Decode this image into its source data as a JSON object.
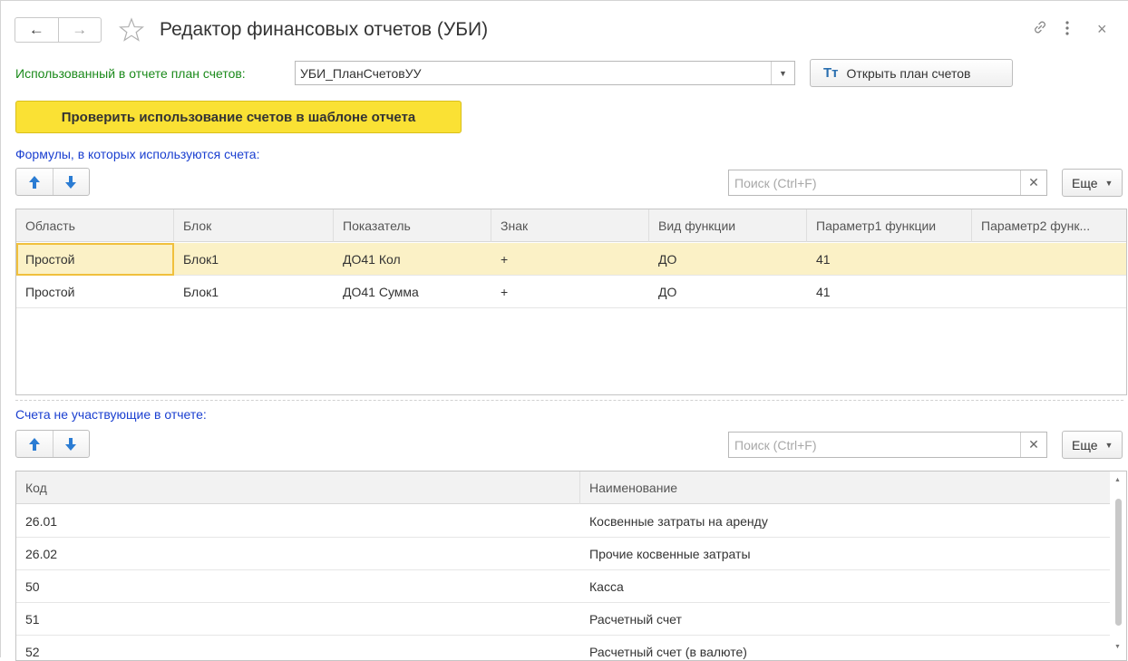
{
  "window": {
    "title": "Редактор финансовых отчетов (УБИ)",
    "nav": {
      "back": "←",
      "forward": "→"
    },
    "toolbar_icons": [
      "link-icon",
      "more-vertical-icon",
      "close-icon"
    ],
    "close_glyph": "×"
  },
  "plan": {
    "label": "Использованный в отчете план счетов:",
    "value": "УБИ_ПланСчетовУУ",
    "open_button": "Открыть план счетов",
    "open_icon": "Тт"
  },
  "check_button": "Проверить использование счетов в шаблоне отчета",
  "formulas": {
    "label": "Формулы, в которых используются счета:",
    "search_placeholder": "Поиск (Ctrl+F)",
    "more_label": "Еще",
    "columns": [
      "Область",
      "Блок",
      "Показатель",
      "Знак",
      "Вид функции",
      "Параметр1 функции",
      "Параметр2 функ..."
    ],
    "rows": [
      [
        "Простой",
        "Блок1",
        "ДО41 Кол",
        "+",
        "ДО",
        "41",
        ""
      ],
      [
        "Простой",
        "Блок1",
        "ДО41 Сумма",
        "+",
        "ДО",
        "41",
        ""
      ]
    ]
  },
  "unused": {
    "label": "Счета не участвующие в отчете:",
    "search_placeholder": "Поиск (Ctrl+F)",
    "more_label": "Еще",
    "columns": [
      "Код",
      "Наименование"
    ],
    "rows": [
      [
        "26.01",
        "Косвенные затраты на аренду"
      ],
      [
        "26.02",
        "Прочие косвенные затраты"
      ],
      [
        "50",
        "Касса"
      ],
      [
        "51",
        "Расчетный счет"
      ],
      [
        "52",
        "Расчетный счет (в валюте)"
      ]
    ]
  },
  "colors": {
    "accent_yellow": "#fae134",
    "selected_row": "#fbf1c6",
    "label_green": "#1b8a1b",
    "label_blue": "#1a3fd0",
    "arrow_blue": "#2b7cd3"
  }
}
